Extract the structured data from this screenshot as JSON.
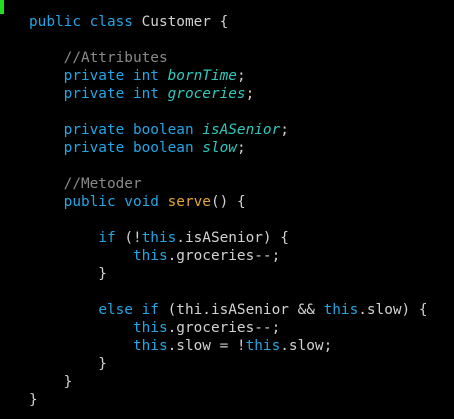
{
  "colors": {
    "background": "#000000",
    "keyword": "#22a6e6",
    "method": "#e6a632",
    "comment": "#8a8a8a",
    "field": "#2fc8bc",
    "text": "#d2d2d2",
    "cursor": "#22dd22"
  },
  "lines": [
    [
      {
        "t": "kw",
        "v": "public class "
      },
      {
        "t": "tx",
        "v": "Customer {"
      }
    ],
    [],
    [
      {
        "t": "tx",
        "v": "    "
      },
      {
        "t": "cm",
        "v": "//Attributes"
      }
    ],
    [
      {
        "t": "tx",
        "v": "    "
      },
      {
        "t": "kw",
        "v": "private int "
      },
      {
        "t": "fd",
        "v": "bornTime"
      },
      {
        "t": "tx",
        "v": ";"
      }
    ],
    [
      {
        "t": "tx",
        "v": "    "
      },
      {
        "t": "kw",
        "v": "private int "
      },
      {
        "t": "fd",
        "v": "groceries"
      },
      {
        "t": "tx",
        "v": ";"
      }
    ],
    [],
    [
      {
        "t": "tx",
        "v": "    "
      },
      {
        "t": "kw",
        "v": "private boolean "
      },
      {
        "t": "fd",
        "v": "isASenior"
      },
      {
        "t": "tx",
        "v": ";"
      }
    ],
    [
      {
        "t": "tx",
        "v": "    "
      },
      {
        "t": "kw",
        "v": "private boolean "
      },
      {
        "t": "fd",
        "v": "slow"
      },
      {
        "t": "tx",
        "v": ";"
      }
    ],
    [],
    [
      {
        "t": "tx",
        "v": "    "
      },
      {
        "t": "cm",
        "v": "//Metoder"
      }
    ],
    [
      {
        "t": "tx",
        "v": "    "
      },
      {
        "t": "kw",
        "v": "public void "
      },
      {
        "t": "fn",
        "v": "serve"
      },
      {
        "t": "tx",
        "v": "() {"
      }
    ],
    [],
    [
      {
        "t": "tx",
        "v": "        "
      },
      {
        "t": "kw",
        "v": "if "
      },
      {
        "t": "tx",
        "v": "(!"
      },
      {
        "t": "kw",
        "v": "this"
      },
      {
        "t": "tx",
        "v": ".isASenior) {"
      }
    ],
    [
      {
        "t": "tx",
        "v": "            "
      },
      {
        "t": "kw",
        "v": "this"
      },
      {
        "t": "tx",
        "v": ".groceries--;"
      }
    ],
    [
      {
        "t": "tx",
        "v": "        }"
      }
    ],
    [],
    [
      {
        "t": "tx",
        "v": "        "
      },
      {
        "t": "kw",
        "v": "else if "
      },
      {
        "t": "tx",
        "v": "(thi.isASenior && "
      },
      {
        "t": "kw",
        "v": "this"
      },
      {
        "t": "tx",
        "v": ".slow) {"
      }
    ],
    [
      {
        "t": "tx",
        "v": "            "
      },
      {
        "t": "kw",
        "v": "this"
      },
      {
        "t": "tx",
        "v": ".groceries--;"
      }
    ],
    [
      {
        "t": "tx",
        "v": "            "
      },
      {
        "t": "kw",
        "v": "this"
      },
      {
        "t": "tx",
        "v": ".slow = !"
      },
      {
        "t": "kw",
        "v": "this"
      },
      {
        "t": "tx",
        "v": ".slow;"
      }
    ],
    [
      {
        "t": "tx",
        "v": "        }"
      }
    ],
    [
      {
        "t": "tx",
        "v": "    }"
      }
    ],
    [
      {
        "t": "tx",
        "v": "}"
      }
    ]
  ]
}
